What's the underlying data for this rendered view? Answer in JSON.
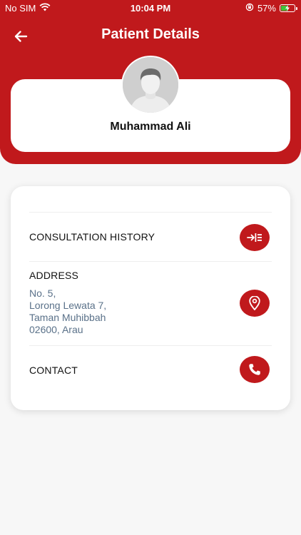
{
  "status_bar": {
    "carrier": "No SIM",
    "time": "10:04 PM",
    "battery_percent": "57%",
    "battery_level": 0.57,
    "icons": [
      "wifi-icon",
      "orientation-lock-icon",
      "battery-charging-icon"
    ]
  },
  "header": {
    "title": "Patient Details",
    "back_icon": "arrow-left-icon",
    "background_color": "#c0191c"
  },
  "patient": {
    "name": "Muhammad Ali",
    "avatar_icon": "user-avatar-placeholder"
  },
  "details": {
    "consultation": {
      "label": "CONSULTATION HISTORY",
      "icon": "list-arrow-icon"
    },
    "address": {
      "label": "ADDRESS",
      "lines": [
        "No. 5,",
        "Lorong Lewata 7,",
        "Taman Muhibbah",
        "02600, Arau"
      ],
      "icon": "location-pin-icon"
    },
    "contact": {
      "label": "CONTACT",
      "icon": "phone-icon"
    }
  },
  "colors": {
    "accent": "#c0191c",
    "address_text": "#5a7189",
    "background": "#f7f7f7"
  }
}
